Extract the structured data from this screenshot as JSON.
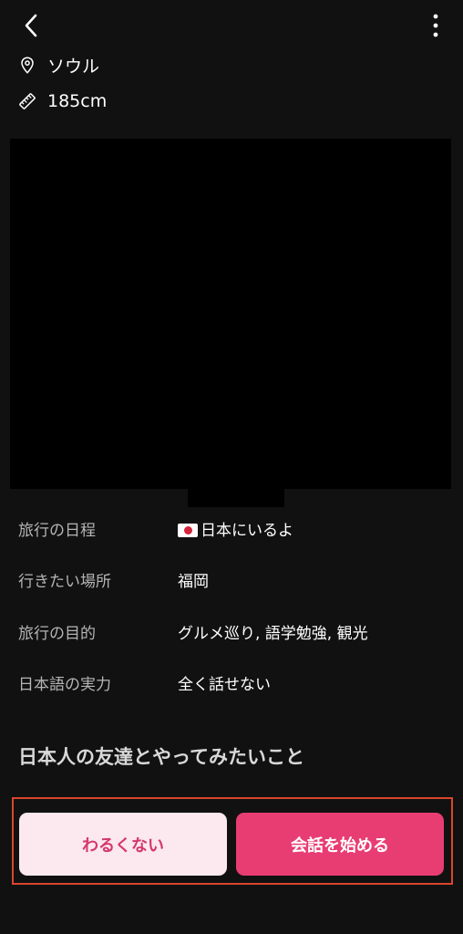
{
  "header": {
    "back_icon": "chevron-left-icon",
    "more_icon": "more-vertical-icon"
  },
  "profile": {
    "location": "ソウル",
    "location_icon": "location-pin-icon",
    "height": "185cm",
    "height_icon": "ruler-icon"
  },
  "details": [
    {
      "label": "旅行の日程",
      "value": "日本にいるよ",
      "flag": "jp-flag-icon"
    },
    {
      "label": "行きたい場所",
      "value": "福岡"
    },
    {
      "label": "旅行の目的",
      "value": "グルメ巡り, 語学勉強, 観光"
    },
    {
      "label": "日本語の実力",
      "value": "全く話せない"
    }
  ],
  "section": {
    "title": "日本人の友達とやってみたいこと"
  },
  "actions": {
    "decline_label": "わるくない",
    "start_label": "会話を始める"
  },
  "colors": {
    "background": "#111111",
    "accent": "#e83d72",
    "accent_light": "#fce8ef",
    "highlight_frame": "#d9462b"
  }
}
